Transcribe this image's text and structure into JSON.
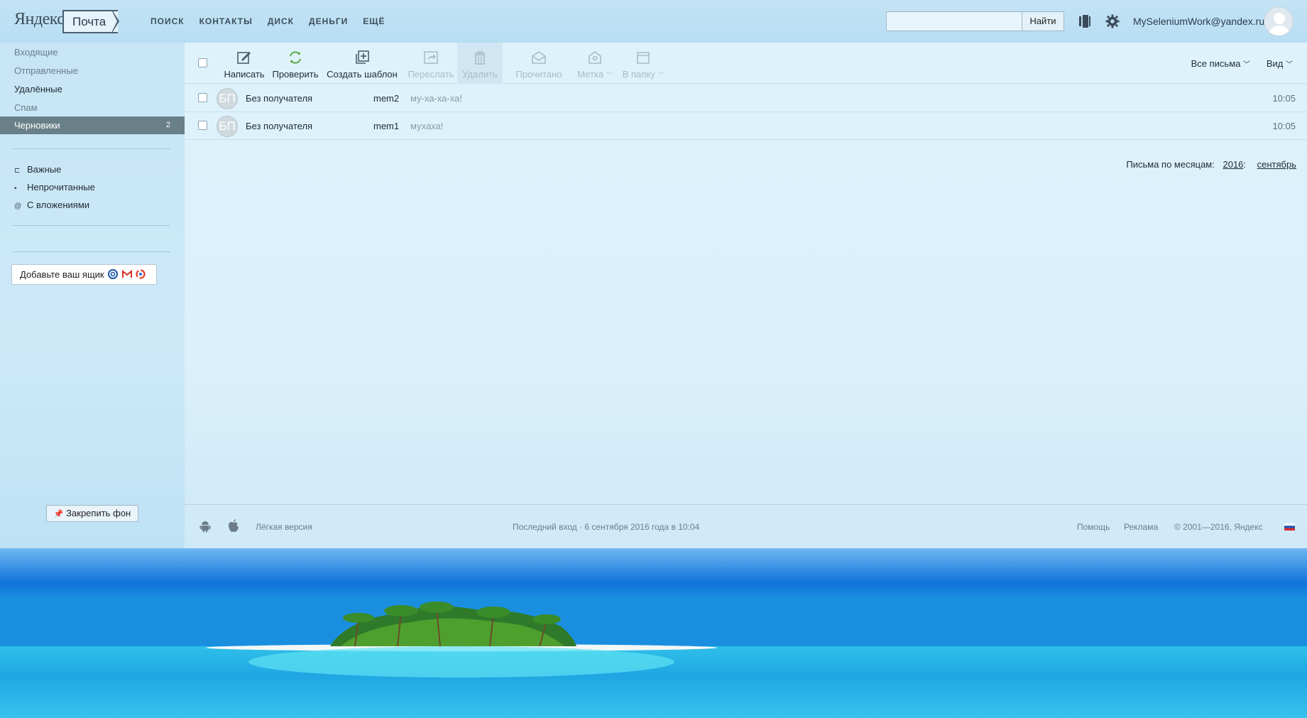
{
  "header": {
    "logo_yandex": "Яндекс",
    "logo_mail": "Почта",
    "nav": [
      "ПОИСК",
      "КОНТАКТЫ",
      "ДИСК",
      "ДЕНЬГИ",
      "ЕЩЁ"
    ],
    "search_value": "",
    "search_button": "Найти",
    "user_email": "MySeleniumWork@yandex.ru"
  },
  "sidebar": {
    "folders": [
      {
        "label": "Входящие",
        "count": ""
      },
      {
        "label": "Отправленные",
        "count": ""
      },
      {
        "label": "Удалённые",
        "count": ""
      },
      {
        "label": "Спам",
        "count": ""
      },
      {
        "label": "Черновики",
        "count": "2"
      }
    ],
    "filters": [
      {
        "label": "Важные",
        "icon": "important-icon"
      },
      {
        "label": "Непрочитанные",
        "icon": "unread-icon"
      },
      {
        "label": "С вложениями",
        "icon": "attachment-icon"
      }
    ],
    "add_mailbox": "Добавьте ваш ящик",
    "pin_background": "Закрепить фон"
  },
  "toolbar": {
    "compose": "Написать",
    "check": "Проверить",
    "create_template": "Создать шаблон",
    "forward": "Переслать",
    "delete": "Удалить",
    "mark_read": "Прочитано",
    "label": "Метка",
    "to_folder": "В папку",
    "all_letters": "Все письма",
    "view": "Вид"
  },
  "messages": [
    {
      "avatar": "БП",
      "from": "Без получателя",
      "subject": "mem2",
      "first_line": "му-ха-ха-ха!",
      "time": "10:05"
    },
    {
      "avatar": "БП",
      "from": "Без получателя",
      "subject": "mem1",
      "first_line": "мухаха!",
      "time": "10:05"
    }
  ],
  "by_months": {
    "label": "Письма по месяцам:",
    "year": "2016",
    "month": "сентябрь"
  },
  "footer": {
    "light_version": "Лёгкая версия",
    "last_login": "Последний вход · 6 сентября 2016 года в 10:04",
    "help": "Помощь",
    "ads": "Реклама",
    "copyright": "© 2001—2016, Яндекс"
  },
  "colors": {
    "active_folder_bg": "#6a8089",
    "sidebar_bg": "#c7e5f6",
    "main_bg": "#def2fb",
    "sea": "#1b97e2"
  }
}
